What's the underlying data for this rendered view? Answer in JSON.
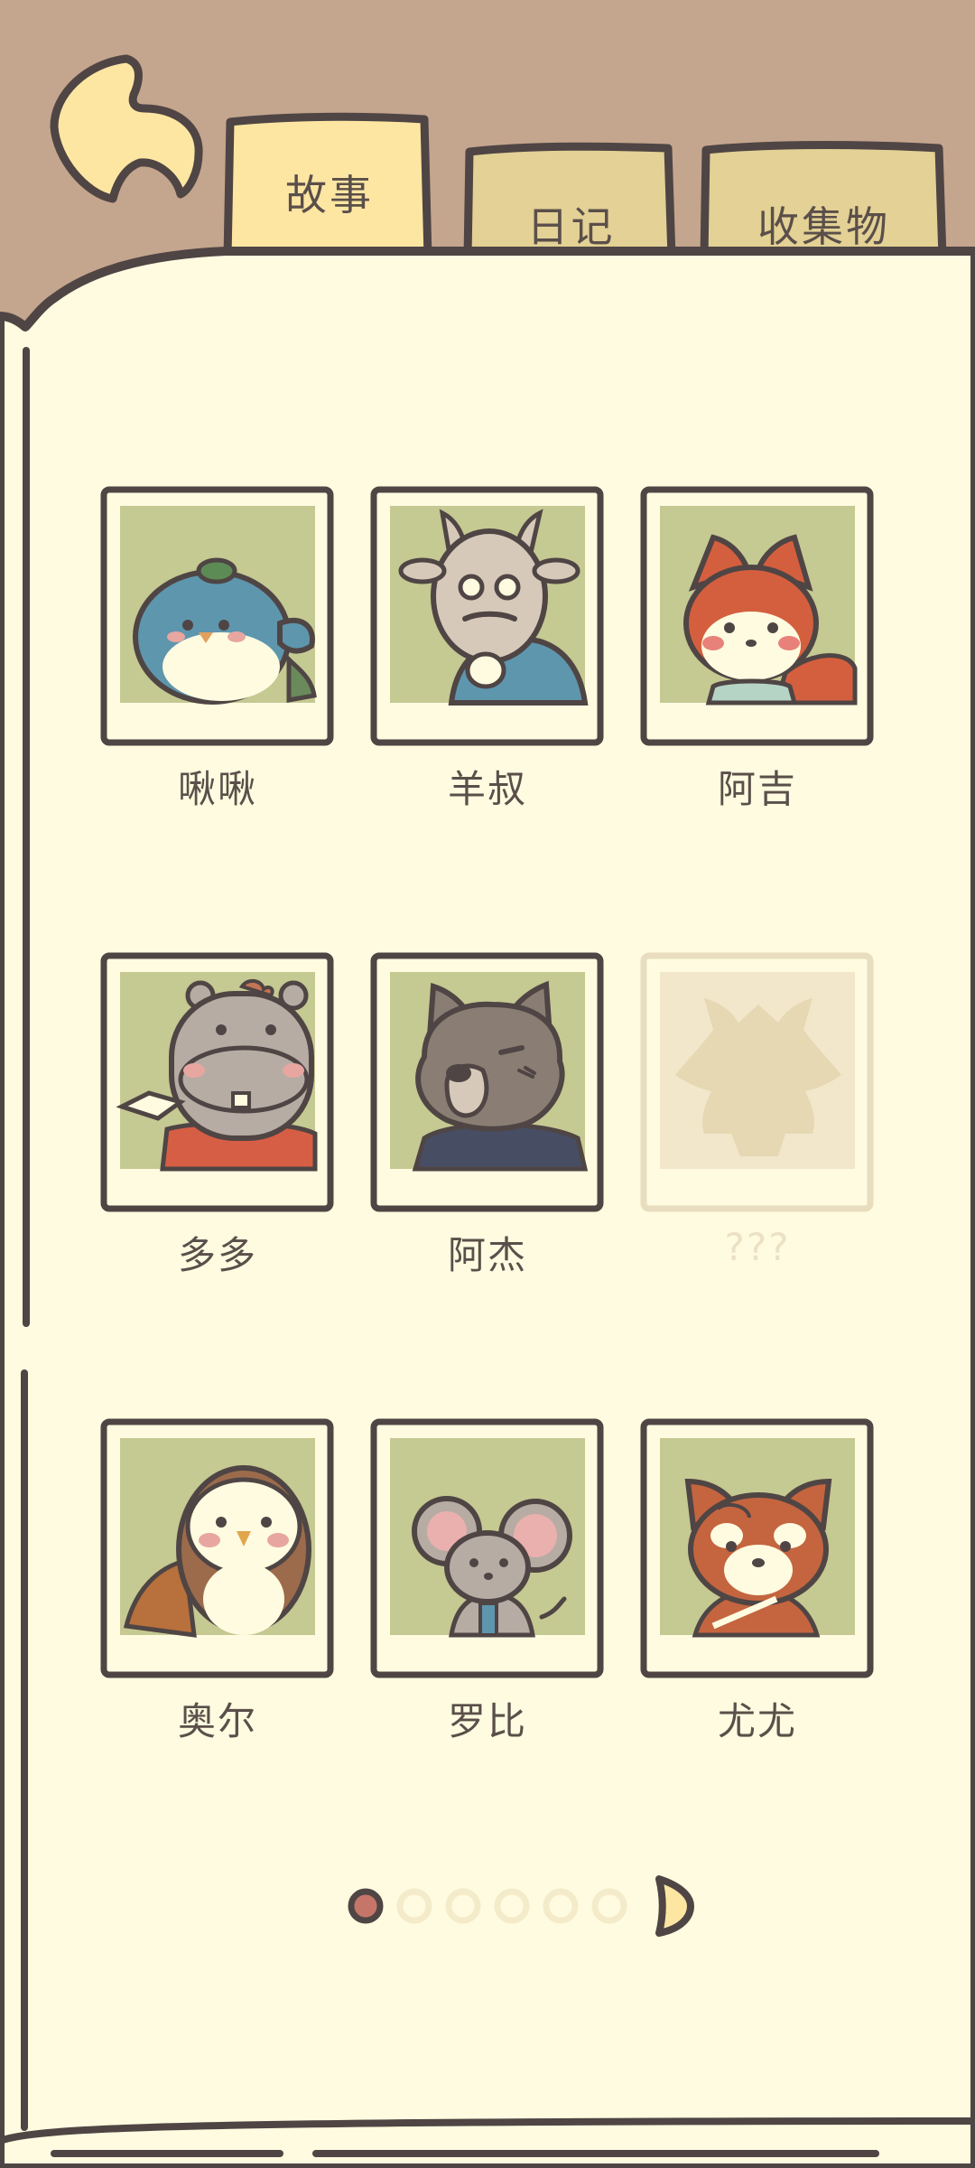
{
  "tabs": [
    {
      "label": "故事",
      "active": true
    },
    {
      "label": "日记",
      "active": false
    },
    {
      "label": "收集物",
      "active": false
    }
  ],
  "characters": [
    {
      "name": "啾啾",
      "icon": "bluebird-icon",
      "unlocked": true
    },
    {
      "name": "羊叔",
      "icon": "goat-icon",
      "unlocked": true
    },
    {
      "name": "阿吉",
      "icon": "fox-icon",
      "unlocked": true
    },
    {
      "name": "多多",
      "icon": "hippo-icon",
      "unlocked": true
    },
    {
      "name": "阿杰",
      "icon": "wolf-icon",
      "unlocked": true
    },
    {
      "name": "???",
      "icon": "locked-silhouette-icon",
      "unlocked": false
    },
    {
      "name": "奥尔",
      "icon": "owl-icon",
      "unlocked": true
    },
    {
      "name": "罗比",
      "icon": "mouse-icon",
      "unlocked": true
    },
    {
      "name": "尤尤",
      "icon": "red-panda-icon",
      "unlocked": true
    }
  ],
  "pagination": {
    "current": 1,
    "total": 6
  },
  "colors": {
    "background": "#c4a58e",
    "paper": "#fefbe0",
    "outline": "#4f4544",
    "tab_active": "#fde6a2",
    "tab_inactive": "#e3d195",
    "portrait_bg": "#c5c992",
    "dot_active": "#c57669",
    "dot_inactive": "#f4ebca",
    "locked": "#e8ddbe"
  }
}
